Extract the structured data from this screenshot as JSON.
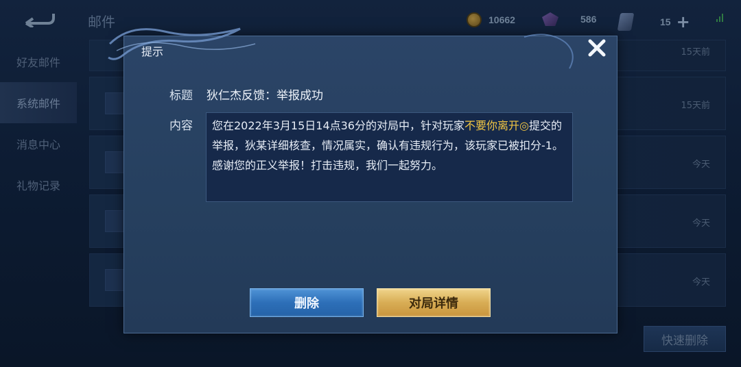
{
  "background": {
    "page_title": "邮件",
    "currencies": [
      {
        "icon": "gold-coin-icon",
        "value": "10662"
      },
      {
        "icon": "diamond-icon",
        "value": "586"
      },
      {
        "icon": "coupon-icon",
        "value": "15"
      }
    ],
    "sidebar": {
      "items": [
        {
          "label": "好友邮件"
        },
        {
          "label": "系统邮件"
        },
        {
          "label": "消息中心"
        },
        {
          "label": "礼物记录"
        }
      ],
      "active_index": 1
    },
    "mail_times": [
      "15天前",
      "15天前",
      "今天",
      "今天",
      "今天"
    ],
    "quick_delete_label": "快速删除"
  },
  "dialog": {
    "header": "提示",
    "title_label": "标题",
    "title_value": "狄仁杰反馈：举报成功",
    "content_label": "内容",
    "content": {
      "part1": "您在2022年3月15日14点36分的对局中，针对玩家",
      "player_name": "不要你离开◎",
      "part2": "提交的举报，狄某详细核查，情况属实，确认有违规行为，该玩家已被扣分-1。感谢您的正义举报！打击违规，我们一起努力。"
    },
    "buttons": {
      "delete": "删除",
      "match_details": "对局详情"
    }
  },
  "colors": {
    "highlight": "#f2c643",
    "delete_button": "#2d6fb8",
    "detail_button": "#d8ad55"
  }
}
